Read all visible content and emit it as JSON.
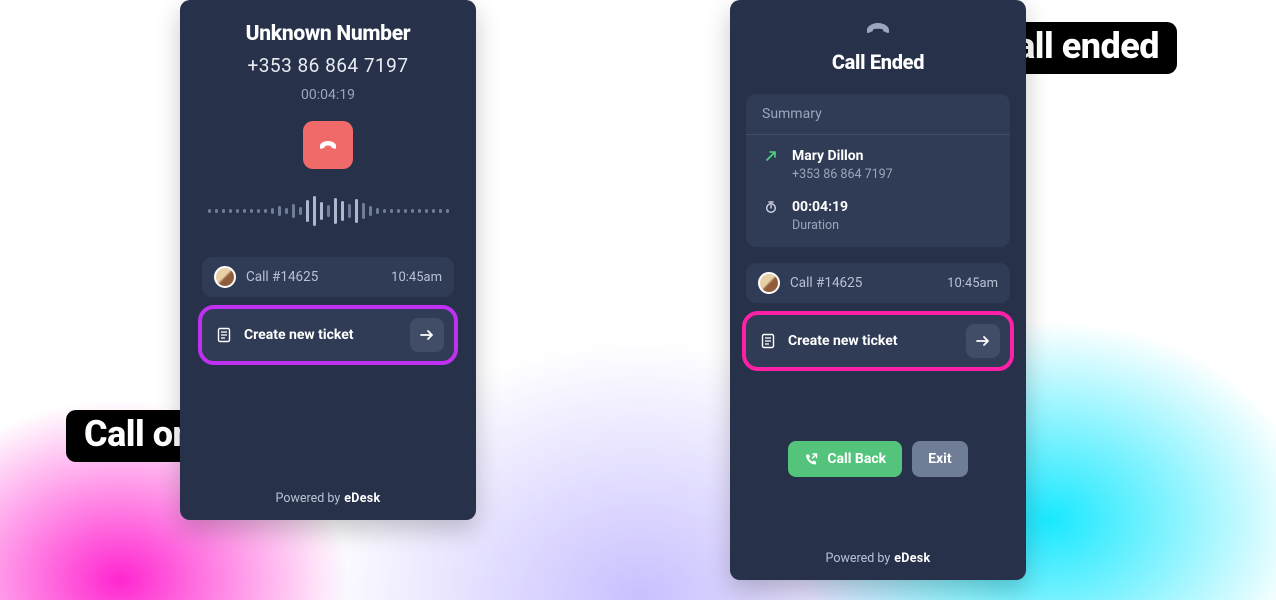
{
  "annotations": {
    "ongoing": "Call ongoing",
    "ended": "Call ended"
  },
  "left_panel": {
    "caller_name": "Unknown Number",
    "caller_number": "+353 86 864 7197",
    "duration": "00:04:19",
    "ticket": {
      "label": "Call #14625",
      "time": "10:45am"
    },
    "create_label": "Create new ticket",
    "footer_prefix": "Powered by",
    "footer_brand": "eDesk"
  },
  "right_panel": {
    "title": "Call Ended",
    "summary": {
      "header": "Summary",
      "caller_name": "Mary Dillon",
      "caller_number": "+353 86 864 7197",
      "duration_value": "00:04:19",
      "duration_label": "Duration"
    },
    "ticket": {
      "label": "Call #14625",
      "time": "10:45am"
    },
    "create_label": "Create new ticket",
    "callback_label": "Call Back",
    "exit_label": "Exit",
    "footer_prefix": "Powered by",
    "footer_brand": "eDesk"
  }
}
